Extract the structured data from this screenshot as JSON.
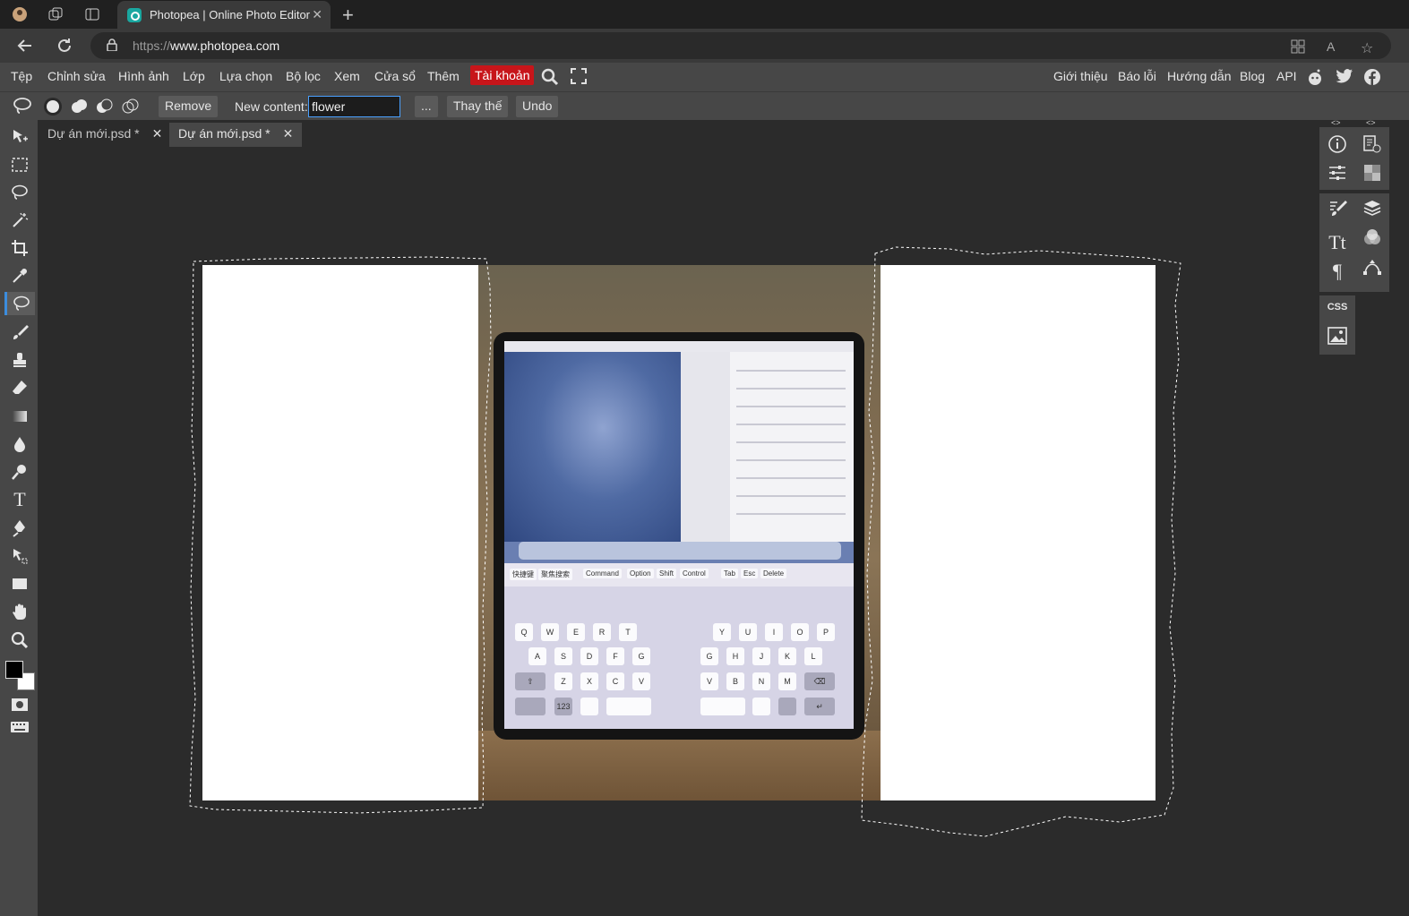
{
  "browser": {
    "tab_title": "Photopea | Online Photo Editor",
    "url_prefix": "https://",
    "url_domain": "www.photopea.com"
  },
  "menu": {
    "items": [
      "Tệp",
      "Chỉnh sửa",
      "Hình ảnh",
      "Lớp",
      "Lựa chọn",
      "Bộ lọc",
      "Xem",
      "Cửa sổ",
      "Thêm"
    ],
    "account": "Tài khoản",
    "right_items": [
      "Giới thiệu",
      "Báo lỗi",
      "Hướng dẫn",
      "Blog",
      "API"
    ],
    "account_color": "#c7151a"
  },
  "options": {
    "remove": "Remove",
    "new_content_label": "New content:",
    "new_content_value": "flower",
    "more": "...",
    "replace": "Thay thế",
    "undo": "Undo"
  },
  "documents": {
    "tabs": [
      {
        "label": "Dự án mới.psd *",
        "close": "✕"
      },
      {
        "label": "Dự án mới.psd *",
        "close": "✕"
      }
    ]
  },
  "right_panel": {
    "css_label": "CSS",
    "collapse_glyph": "<>"
  },
  "photo_keyboard": {
    "strip": [
      "快捷键",
      "聚焦搜索",
      "Command",
      "Option",
      "Shift",
      "Control",
      "Tab",
      "Esc",
      "Delete"
    ],
    "row1_left": [
      "Q",
      "W",
      "E",
      "R",
      "T"
    ],
    "row1_right": [
      "Y",
      "U",
      "I",
      "O",
      "P"
    ],
    "row2_left": [
      "A",
      "S",
      "D",
      "F",
      "G"
    ],
    "row2_right": [
      "G",
      "H",
      "J",
      "K",
      "L"
    ],
    "row3_left": [
      "Z",
      "X",
      "C",
      "V"
    ],
    "row3_right": [
      "V",
      "B",
      "N",
      "M"
    ],
    "num_key": "123"
  }
}
